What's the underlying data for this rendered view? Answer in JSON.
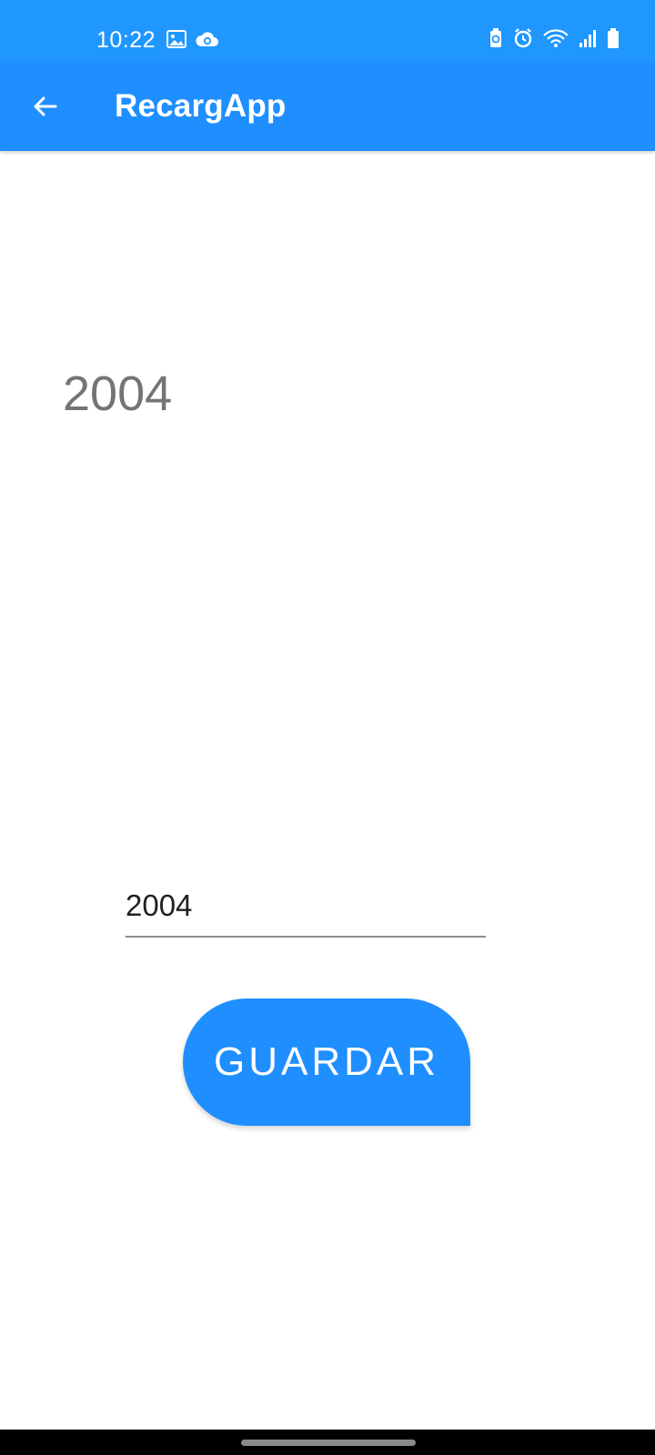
{
  "status_bar": {
    "time": "10:22",
    "left_icons": [
      "gallery-icon",
      "cloud-sync-icon"
    ],
    "right_icons": [
      "battery-saver-icon",
      "alarm-icon",
      "wifi-icon",
      "signal-icon",
      "battery-icon"
    ]
  },
  "app_bar": {
    "title": "RecargApp",
    "back_icon": "arrow-back-icon"
  },
  "main": {
    "display_value": "2004",
    "input_value": "2004",
    "save_button_label": "GUARDAR"
  },
  "colors": {
    "status_bar": "#1f97ff",
    "app_bar": "#1f8fff",
    "button": "#1f8fff",
    "display_text": "#747474",
    "input_text": "#222222",
    "input_underline": "#8b8b8b"
  }
}
